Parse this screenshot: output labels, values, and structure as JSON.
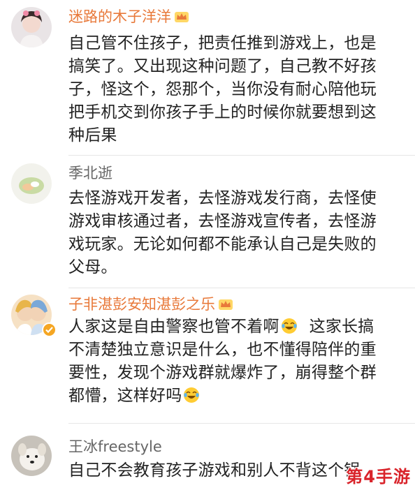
{
  "comments": [
    {
      "username": "迷路的木子洋洋",
      "vip": true,
      "lines": [
        "自己管不住孩子，把责任推到游戏上，也是",
        "搞笑了。又出现这种问题了，自己教不好孩",
        "子，怪这个，怨那个，当你没有耐心陪他玩",
        "把手机交到你孩子手上的时候你就要想到这",
        "种后果"
      ]
    },
    {
      "username": "季北逝",
      "vip": false,
      "lines": [
        "去怪游戏开发者，去怪游戏发行商，去怪使",
        "游戏审核通过者，去怪游戏宣传者，去怪游",
        "戏玩家。无论如何都不能承认自己是失败的",
        "父母。"
      ]
    },
    {
      "username": "子非湛彭安知湛彭之乐",
      "vip": true,
      "verified": true,
      "lines": [
        "人家这是自由警察也管不着啊",
        "不清楚独立意识是什么，也不懂得陪伴的重",
        "要性，发现个游戏群就爆炸了，崩得整个群",
        "都懵，这样好吗"
      ],
      "line1_tail": "这家长搞",
      "emoji_name": "laughing-crying-emoji"
    },
    {
      "username": "王冰freestyle",
      "vip": false,
      "lines": [
        "自己不会教育孩子游戏和别人不背这个锅"
      ]
    }
  ],
  "watermark": "第4手游",
  "colors": {
    "vip_name": "#e8793a",
    "normal_name": "#666666",
    "text": "#222222",
    "watermark": "#d9232a"
  }
}
